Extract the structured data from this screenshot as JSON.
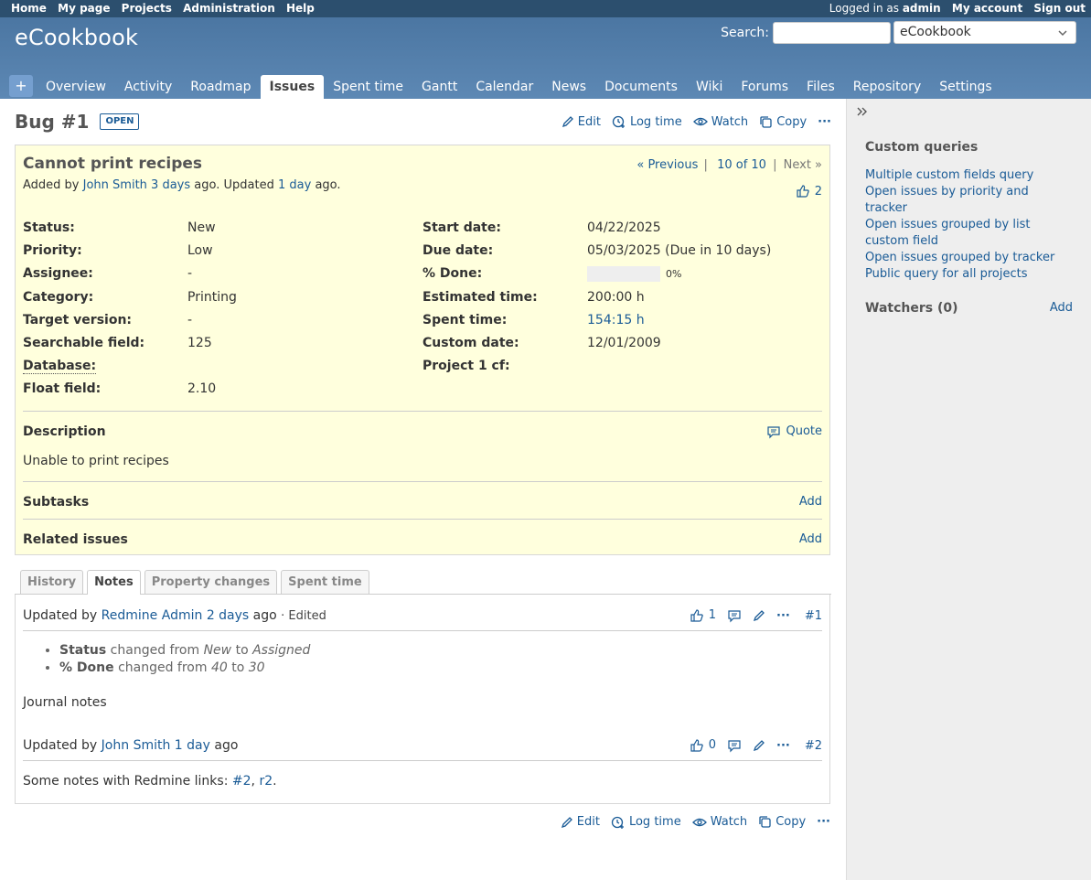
{
  "top_menu": {
    "left": [
      "Home",
      "My page",
      "Projects",
      "Administration",
      "Help"
    ],
    "logged_in_prefix": "Logged in as",
    "user": "admin",
    "my_account": "My account",
    "sign_out": "Sign out"
  },
  "header": {
    "title": "eCookbook",
    "search_label": "Search:",
    "project_select": "eCookbook"
  },
  "main_menu": {
    "new_label": "+",
    "tabs": [
      "Overview",
      "Activity",
      "Roadmap",
      "Issues",
      "Spent time",
      "Gantt",
      "Calendar",
      "News",
      "Documents",
      "Wiki",
      "Forums",
      "Files",
      "Repository",
      "Settings"
    ],
    "selected": "Issues"
  },
  "actions": {
    "edit": "Edit",
    "log_time": "Log time",
    "watch": "Watch",
    "copy": "Copy",
    "more": "···"
  },
  "issue": {
    "heading": "Bug #1",
    "status_badge": "OPEN",
    "subject": "Cannot print recipes",
    "nav": {
      "previous": "« Previous",
      "sep": "|",
      "position": "10 of 10",
      "next": "Next »"
    },
    "added_by_prefix": "Added by",
    "author": "John Smith",
    "added_ago": "3 days",
    "updated_text": "ago. Updated",
    "updated_ago": "1 day",
    "ago_suffix": "ago.",
    "reactions": "2",
    "attributes_left": [
      {
        "label": "Status:",
        "value": "New"
      },
      {
        "label": "Priority:",
        "value": "Low"
      },
      {
        "label": "Assignee:",
        "value": "-"
      },
      {
        "label": "Category:",
        "value": "Printing"
      },
      {
        "label": "Target version:",
        "value": "-"
      },
      {
        "label": "Searchable field:",
        "value": "125"
      },
      {
        "label": "Database:",
        "value": ""
      },
      {
        "label": "Float field:",
        "value": "2.10"
      }
    ],
    "attributes_right": [
      {
        "label": "Start date:",
        "value": "04/22/2025"
      },
      {
        "label": "Due date:",
        "value": "05/03/2025 (Due in 10 days)"
      },
      {
        "label": "% Done:",
        "value": "0%",
        "progress": 0
      },
      {
        "label": "Estimated time:",
        "value": "200:00 h"
      },
      {
        "label": "Spent time:",
        "value": "154:15 h"
      },
      {
        "label": "Custom date:",
        "value": "12/01/2009"
      },
      {
        "label": "Project 1 cf:",
        "value": ""
      },
      {
        "label": "",
        "value": ""
      }
    ],
    "description_title": "Description",
    "quote": "Quote",
    "description": "Unable to print recipes",
    "subtasks_title": "Subtasks",
    "related_title": "Related issues",
    "add": "Add"
  },
  "history_tabs": [
    "History",
    "Notes",
    "Property changes",
    "Spent time"
  ],
  "history_selected": "Notes",
  "journals": [
    {
      "prefix": "Updated by",
      "user": "Redmine Admin",
      "ago": "2 days",
      "suffix": "ago",
      "edited": "· Edited",
      "reactions": "1",
      "number": "#1",
      "changes": [
        {
          "field": "Status",
          "text": "changed from",
          "from": "New",
          "to_word": "to",
          "to": "Assigned"
        },
        {
          "field": "% Done",
          "text": "changed from",
          "from": "40",
          "to_word": "to",
          "to": "30"
        }
      ],
      "notes": "Journal notes"
    },
    {
      "prefix": "Updated by",
      "user": "John Smith",
      "ago": "1 day",
      "suffix": "ago",
      "reactions": "0",
      "number": "#2",
      "notes_prefix": "Some notes with Redmine links:",
      "link1": "#2",
      "link2": "r2",
      "comma": ",",
      "period": "."
    }
  ],
  "sidebar": {
    "custom_queries_title": "Custom queries",
    "queries": [
      "Multiple custom fields query",
      "Open issues by priority and tracker",
      "Open issues grouped by list custom field",
      "Open issues grouped by tracker",
      "Public query for all projects"
    ],
    "watchers_title": "Watchers (0)",
    "watchers_add": "Add"
  },
  "colors": {
    "header": "#4f7ba7",
    "top_menu": "#2c4f6e",
    "link": "#1a5b96",
    "issue_bg": "#ffffdd",
    "sidebar_bg": "#eeeeee"
  }
}
